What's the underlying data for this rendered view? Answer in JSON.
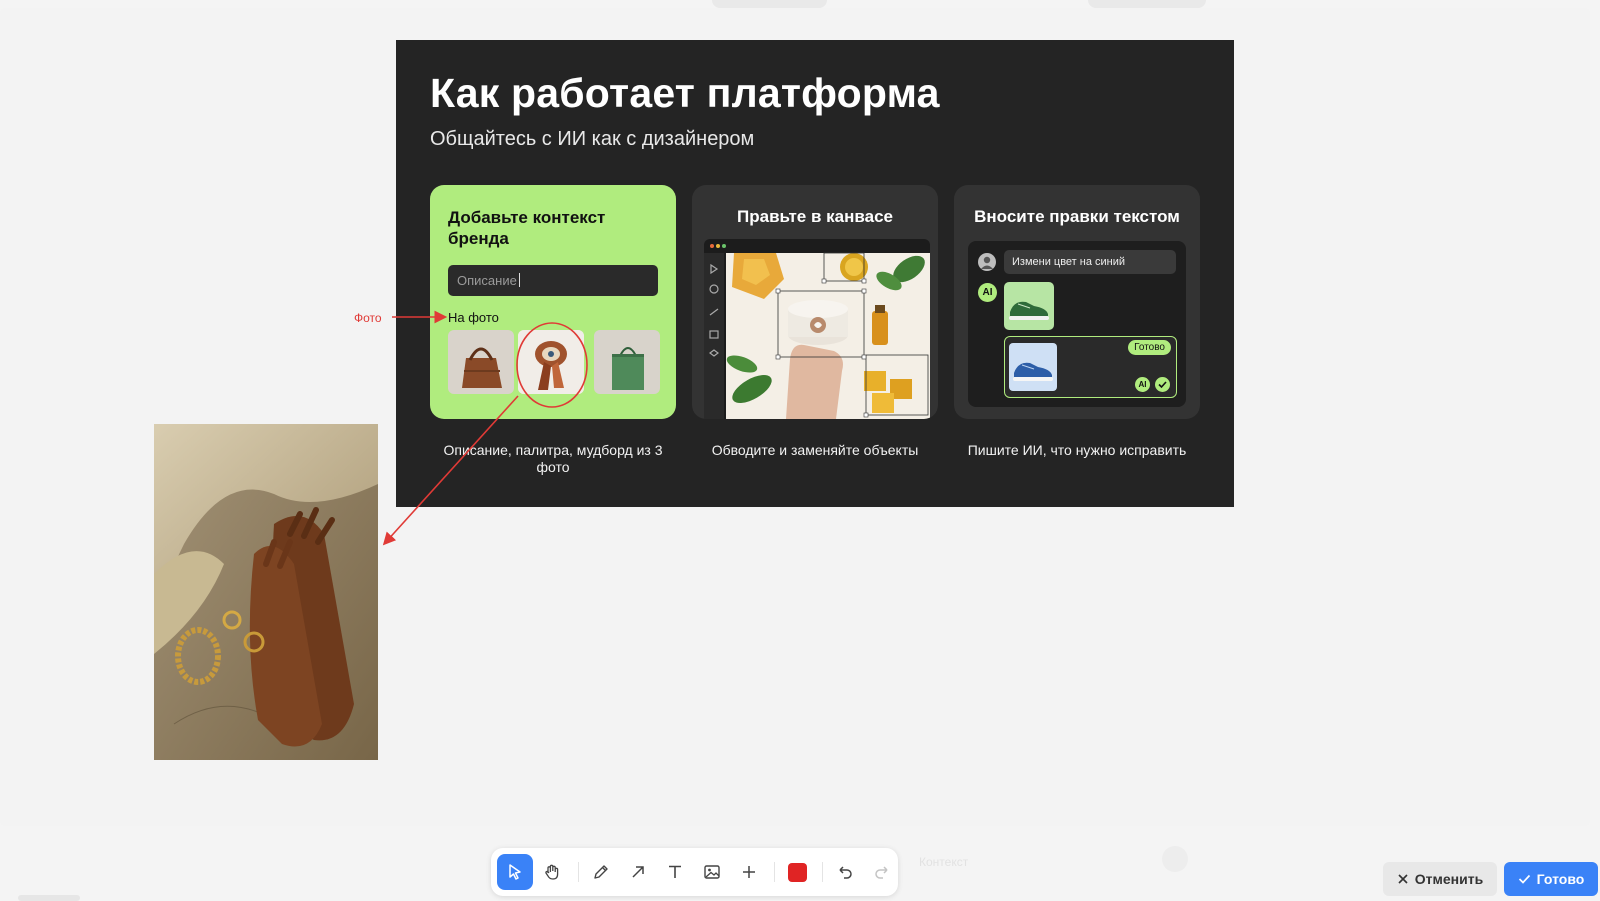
{
  "slide": {
    "title": "Как работает платформа",
    "subtitle": "Общайтесь с ИИ как с дизайнером",
    "cards": [
      {
        "heading": "Добавьте контекст бренда",
        "input_placeholder": "Описание",
        "photo_label": "На фото",
        "caption": "Описание, палитра, мудборд из 3 фото"
      },
      {
        "heading": "Правьте в канвасе",
        "caption": "Обводите и заменяйте объекты"
      },
      {
        "heading": "Вносите правки текстом",
        "chat_message": "Измени цвет на синий",
        "ai_badge": "AI",
        "done_badge": "Готово",
        "caption": "Пишите ИИ, что нужно исправить"
      }
    ]
  },
  "annotation": {
    "label": "Фото",
    "color": "#e03a36"
  },
  "toolbar": {
    "tools": [
      "select-icon",
      "hand-icon",
      "pencil-icon",
      "arrow-icon",
      "text-icon",
      "image-icon",
      "plus-icon",
      "color-swatch",
      "undo-icon",
      "redo-icon"
    ],
    "active_tool": "select-icon",
    "current_color": "#e02424"
  },
  "actions": {
    "cancel_label": "Отменить",
    "done_label": "Готово"
  },
  "background": {
    "ghost_context": "Контекст"
  },
  "colors": {
    "accent": "#3a82f7",
    "card_green": "#b0ec7e",
    "slide_bg": "#242424"
  }
}
